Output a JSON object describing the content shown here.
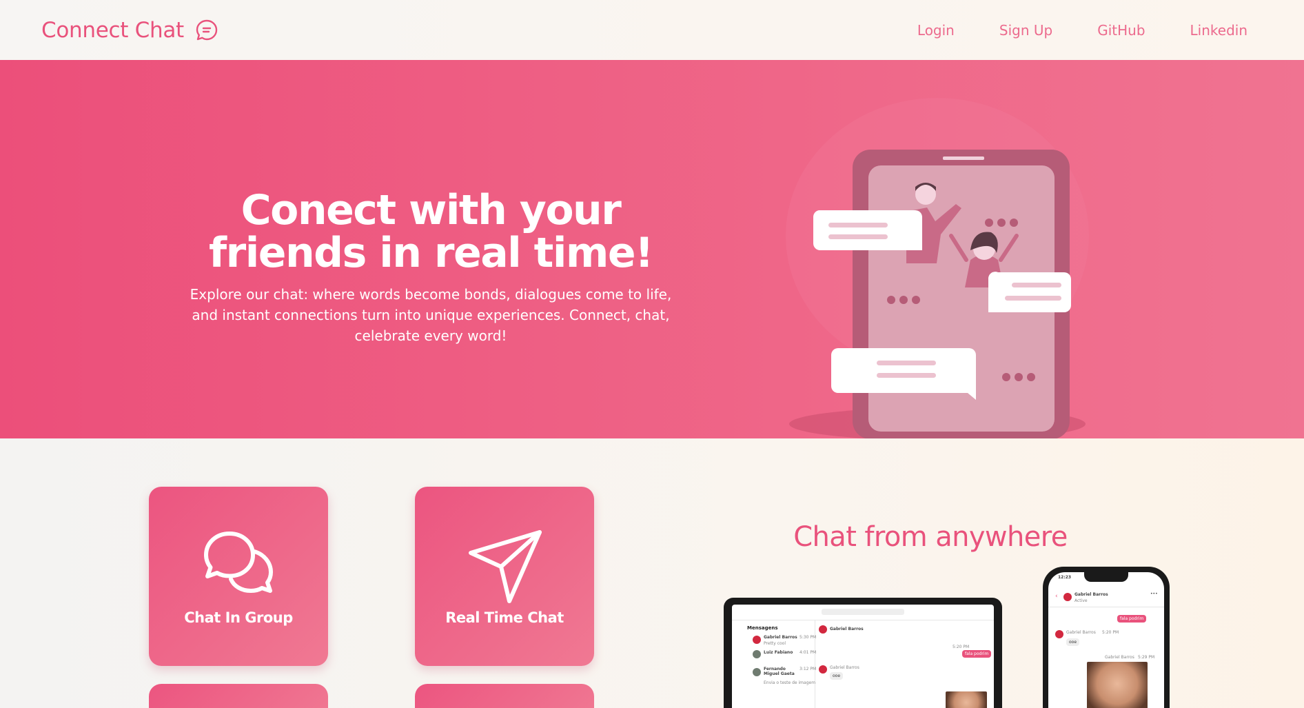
{
  "header": {
    "brand": "Connect Chat",
    "brand_icon": "chat-bubble-icon",
    "nav": [
      "Login",
      "Sign Up",
      "GitHub",
      "Linkedin"
    ]
  },
  "hero": {
    "title_line1": "Conect with your",
    "title_line2": "friends in real time!",
    "description": "Explore our chat: where words become bonds, dialogues come to life, and instant connections turn into unique experiences. Connect, chat, celebrate every word!"
  },
  "features": {
    "cards": [
      {
        "label": "Chat In Group",
        "icon": "chat-bubbles-icon"
      },
      {
        "label": "Real Time Chat",
        "icon": "paper-plane-icon"
      }
    ],
    "anywhere_title": "Chat from anywhere"
  },
  "devices": {
    "laptop": {
      "inbox_title": "Mensagens",
      "conversations": [
        {
          "name": "Gabriel Barros",
          "time": "5:30 PM",
          "preview": "Pretty cool"
        },
        {
          "name": "Luiz Fabiano",
          "time": "4:01 PM",
          "preview": ""
        },
        {
          "name": "Fernando Miguel Gaeta",
          "time": "3:12 PM",
          "preview": "Envia o teste de imagem"
        }
      ],
      "chat_header_name": "Gabriel Barros",
      "messages": [
        {
          "from": "Gabriel Barros",
          "time": "5:20 PM",
          "text": "fala podrim"
        },
        {
          "from": "Gabriel Barros",
          "time": "5:22 PM",
          "text": "ooe"
        }
      ]
    },
    "phone": {
      "status_time": "12:23",
      "contact_name": "Gabriel Barros",
      "contact_status": "Active",
      "messages": [
        {
          "text": "fala podrim"
        },
        {
          "from": "Gabriel Barros",
          "time": "5:20 PM",
          "text": "ooe"
        },
        {
          "from": "Gabriel Barros",
          "time": "5:29 PM",
          "text": ""
        }
      ]
    }
  },
  "colors": {
    "accent": "#e9527c",
    "hero_gradient_start": "#ec4f7a",
    "hero_gradient_end": "#f07391"
  }
}
